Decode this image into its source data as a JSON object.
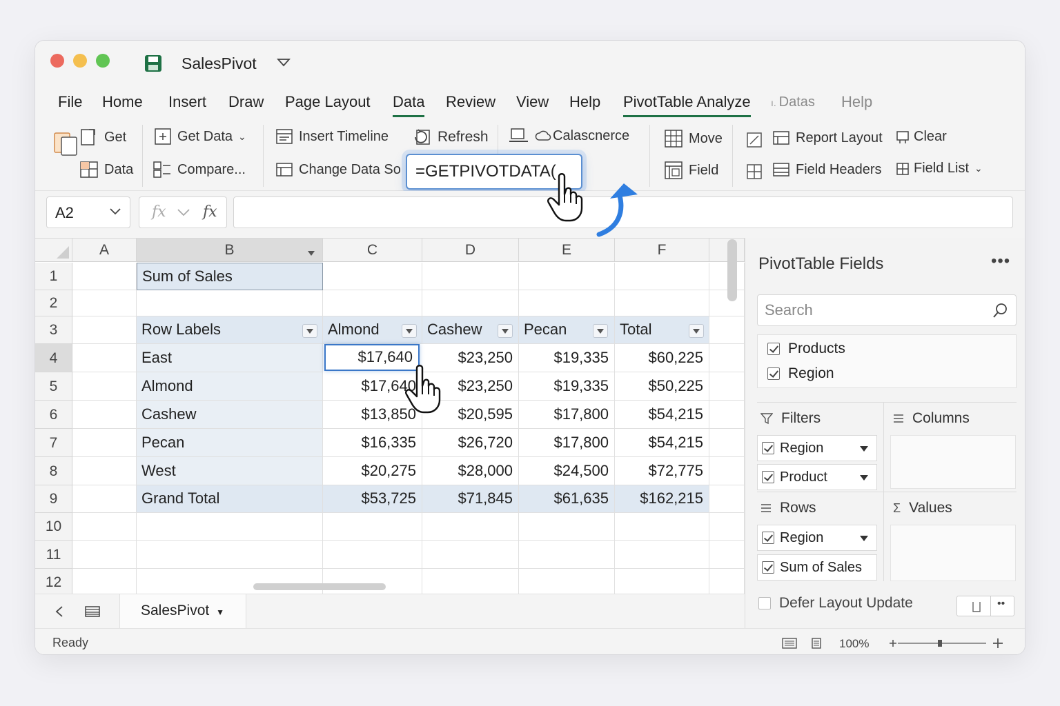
{
  "app": {
    "title": "SalesPivot",
    "accent_color": "#1e7145",
    "selection_color": "#3a77c8"
  },
  "menu": {
    "items": [
      "File",
      "Home",
      "Insert",
      "Draw",
      "Page Layout",
      "Data",
      "Review",
      "View",
      "Help",
      "PivotTable Analyze",
      "Datas",
      "Help"
    ],
    "active": "Data"
  },
  "ribbon": {
    "get": "Get",
    "data": "Data",
    "get_data": "Get Data",
    "compare": "Compare...",
    "insert_timeline": "Insert Timeline",
    "change_data_source": "Change Data So",
    "refresh": "Refresh",
    "calascnerce": "Calascnerce",
    "move": "Move",
    "field": "Field",
    "report_layout": "Report Layout",
    "clear": "Clear",
    "field_headers": "Field Headers",
    "field_list": "Field List",
    "formula_popup": "=GETPIVOTDATA("
  },
  "formula_bar": {
    "name_box": "A2",
    "fx": "fx",
    "value": ""
  },
  "sheet": {
    "columns": [
      "A",
      "B",
      "C",
      "D",
      "E",
      "F"
    ],
    "rows": [
      "1",
      "2",
      "3",
      "4",
      "5",
      "6",
      "7",
      "8",
      "9",
      "10",
      "11",
      "12"
    ],
    "values_header": "Sum of Sales",
    "pivot_headers": [
      "Row Labels",
      "Almond",
      "Cashew",
      "Pecan",
      "Total"
    ],
    "pivot_rows": [
      {
        "label": "East",
        "values": [
          "$17,640",
          "$23,250",
          "$19,335",
          "$60,225"
        ]
      },
      {
        "label": "Almond",
        "values": [
          "$17,640",
          "$23,250",
          "$19,335",
          "$50,225"
        ]
      },
      {
        "label": "Cashew",
        "values": [
          "$13,850",
          "$20,595",
          "$17,800",
          "$54,215"
        ]
      },
      {
        "label": "Pecan",
        "values": [
          "$16,335",
          "$26,720",
          "$17,800",
          "$54,215"
        ]
      },
      {
        "label": "West",
        "values": [
          "$20,275",
          "$28,000",
          "$24,500",
          "$72,775"
        ]
      }
    ],
    "grand_total": {
      "label": "Grand Total",
      "values": [
        "$53,725",
        "$71,845",
        "$61,635",
        "$162,215"
      ]
    },
    "tab": "SalesPivot"
  },
  "panel": {
    "title": "PivotTable Fields",
    "more": "•••",
    "search_placeholder": "Search",
    "fields": [
      {
        "label": "Products",
        "checked": true
      },
      {
        "label": "Region",
        "checked": true
      }
    ],
    "areas": {
      "filters": {
        "label": "Filters",
        "items": [
          "Region",
          "Product"
        ]
      },
      "columns": {
        "label": "Columns",
        "items": []
      },
      "rows": {
        "label": "Rows",
        "items": [
          "Region",
          "Sum of Sales"
        ]
      },
      "values": {
        "label": "Values",
        "items": []
      }
    },
    "defer_label": "Defer Layout Update"
  },
  "status": {
    "text": "Ready",
    "zoom": "100%"
  }
}
